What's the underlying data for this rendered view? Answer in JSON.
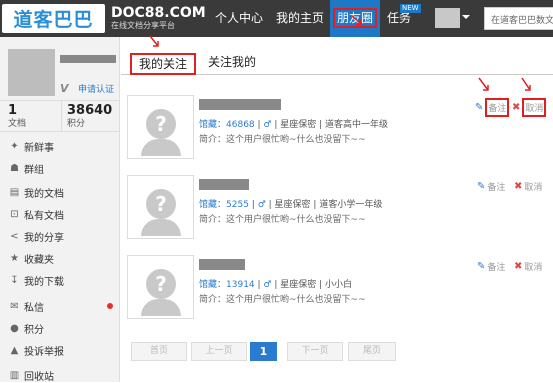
{
  "header": {
    "logo_text": "道客巴巴",
    "brand_name": "DOC88.COM",
    "brand_slogan": "在线文档分享平台",
    "nav": [
      {
        "label": "个人中心"
      },
      {
        "label": "我的主页"
      },
      {
        "label": "朋友圈",
        "active": true
      },
      {
        "label": "任务"
      }
    ],
    "nav_badge": "NEW",
    "search_placeholder": "在道客巴巴数文"
  },
  "sidebar": {
    "verify_label": "申请认证",
    "stats": [
      {
        "value": "1",
        "label": "文档"
      },
      {
        "value": "38640",
        "label": "积分"
      }
    ],
    "menu": [
      {
        "icon": "feed-icon",
        "label": "新鲜事"
      },
      {
        "icon": "group-icon",
        "label": "群组"
      },
      {
        "icon": "document-icon",
        "label": "我的文档"
      },
      {
        "icon": "lock-icon",
        "label": "私有文档"
      },
      {
        "icon": "share-icon",
        "label": "我的分享"
      },
      {
        "icon": "star-icon",
        "label": "收藏夹"
      },
      {
        "icon": "download-icon",
        "label": "我的下载"
      },
      {
        "icon": "mail-icon",
        "label": "私信",
        "badge": true
      },
      {
        "icon": "coin-icon",
        "label": "积分"
      },
      {
        "icon": "warning-icon",
        "label": "投诉举报"
      },
      {
        "icon": "trash-icon",
        "label": "回收站"
      }
    ]
  },
  "tabs": [
    {
      "label": "我的关注",
      "active": true
    },
    {
      "label": "关注我的",
      "active": false
    }
  ],
  "follow_list": [
    {
      "collection_label": "馆藏：",
      "collection_count": "46868",
      "gender_symbol": "♂",
      "constellation": "星座保密",
      "school": "道客高中一年级",
      "intro": "简介：这个用户很忙哟~什么也没留下~~",
      "note_label": "备注",
      "cancel_label": "取消"
    },
    {
      "collection_label": "馆藏：",
      "collection_count": "5255",
      "gender_symbol": "♂",
      "constellation": "星座保密",
      "school": "道客小学一年级",
      "intro": "简介：这个用户很忙哟~什么也没留下~~",
      "note_label": "备注",
      "cancel_label": "取消"
    },
    {
      "collection_label": "馆藏：",
      "collection_count": "13914",
      "gender_symbol": "♂",
      "constellation": "星座保密",
      "school": "小小白",
      "intro": "简介：这个用户很忙哟~什么也没留下~~",
      "note_label": "备注",
      "cancel_label": "取消"
    }
  ],
  "pagination": {
    "first": "首页",
    "prev": "上一页",
    "current": "1",
    "next": "下一页",
    "last": "尾页"
  },
  "colors": {
    "header_bg": "#3a3a3a",
    "accent": "#2a7bd0",
    "highlight": "#e02020"
  }
}
